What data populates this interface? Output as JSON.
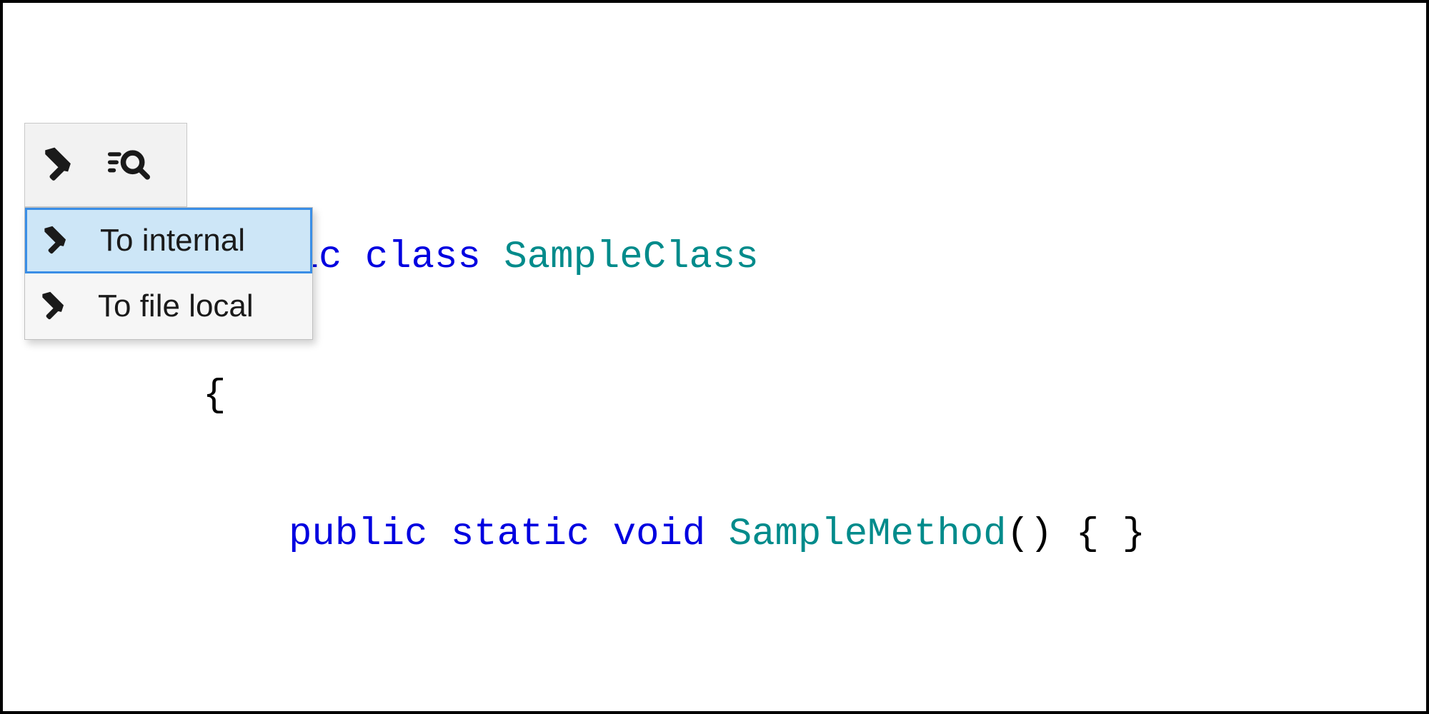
{
  "code": {
    "line1": {
      "kw1": "public",
      "kw2": "class",
      "name": "SampleClass"
    },
    "line2": "{",
    "line3": {
      "kw1": "public",
      "kw2": "static",
      "kw3": "void",
      "name": "SampleMethod",
      "rest": "() { }"
    }
  },
  "menu": {
    "items": [
      {
        "label": "To internal"
      },
      {
        "label": "To file local"
      }
    ]
  }
}
